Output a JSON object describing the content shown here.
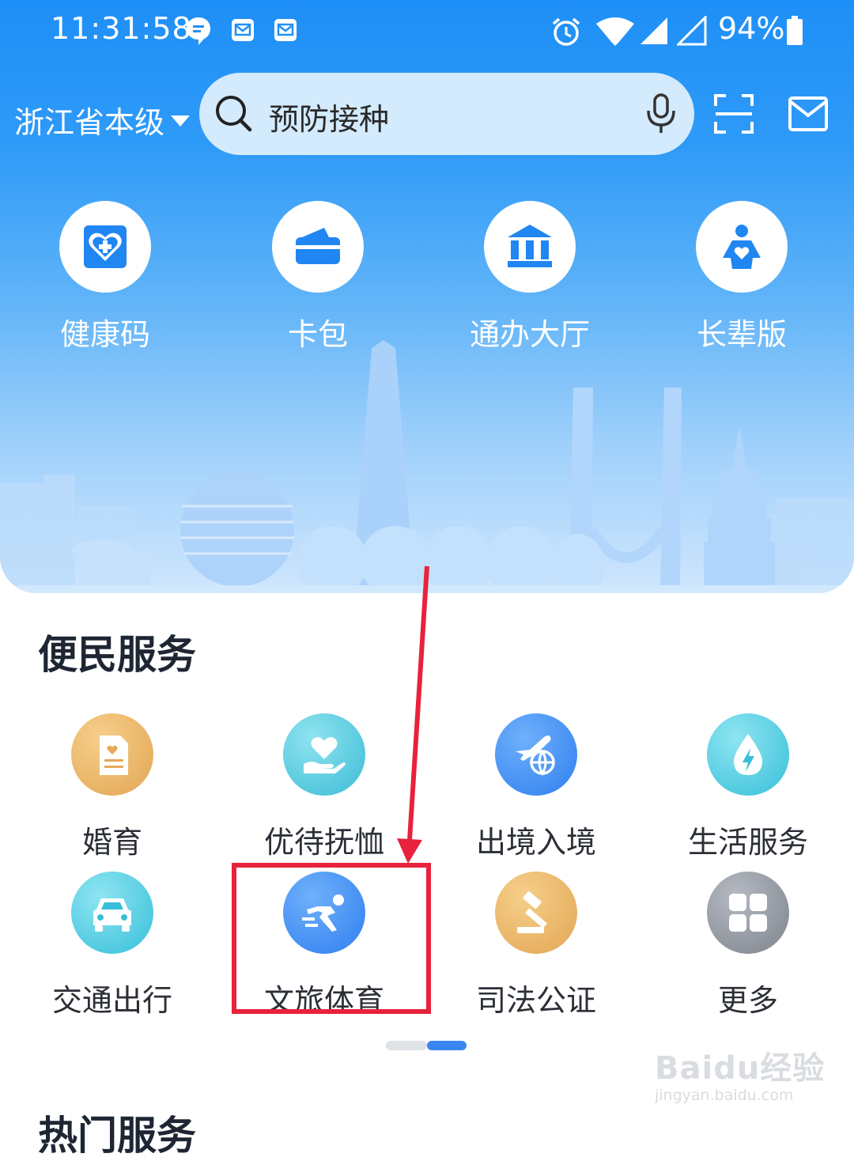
{
  "status_bar": {
    "time": "11:31:58",
    "battery": "94%"
  },
  "header": {
    "region": "浙江省本级",
    "search_placeholder": "预防接种"
  },
  "quick_entries": [
    {
      "label": "健康码",
      "icon": "health-code-icon"
    },
    {
      "label": "卡包",
      "icon": "wallet-icon"
    },
    {
      "label": "通办大厅",
      "icon": "hall-icon"
    },
    {
      "label": "长辈版",
      "icon": "elder-icon"
    }
  ],
  "convenience": {
    "title": "便民服务",
    "items": [
      {
        "label": "婚育",
        "icon": "marriage-icon",
        "color": "#e9b25e"
      },
      {
        "label": "优待抚恤",
        "icon": "care-icon",
        "color": "#4cc3d9"
      },
      {
        "label": "出境入境",
        "icon": "plane-icon",
        "color": "#3a86f0"
      },
      {
        "label": "生活服务",
        "icon": "utility-icon",
        "color": "#44c4dc"
      },
      {
        "label": "交通出行",
        "icon": "car-icon",
        "color": "#4cc3d9"
      },
      {
        "label": "文旅体育",
        "icon": "sport-icon",
        "color": "#3a86f0"
      },
      {
        "label": "司法公证",
        "icon": "gavel-icon",
        "color": "#e9a85a"
      },
      {
        "label": "更多",
        "icon": "grid-icon",
        "color": "#8e939c"
      }
    ]
  },
  "hot_services": {
    "title": "热门服务"
  },
  "watermark": {
    "line1": "Baidu经验",
    "line2": "jingyan.baidu.com"
  }
}
